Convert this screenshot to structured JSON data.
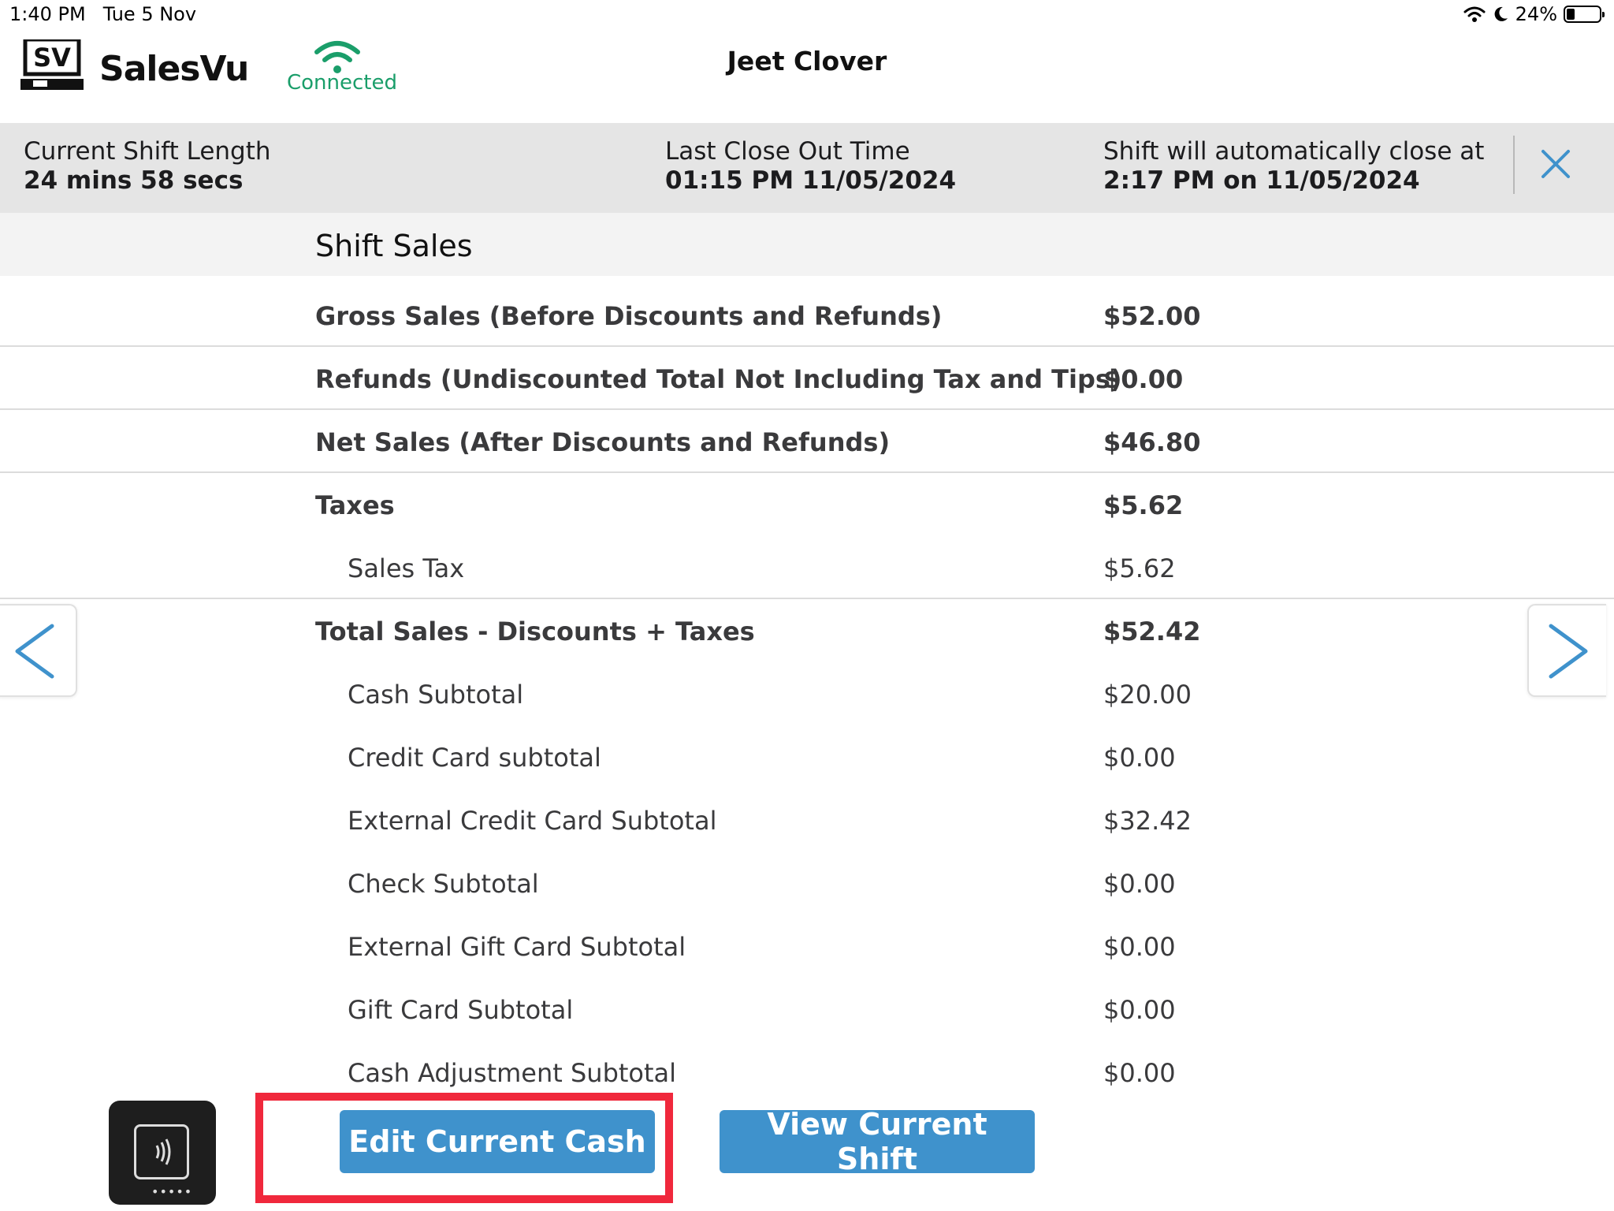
{
  "status_bar": {
    "time": "1:40 PM",
    "date": "Tue 5 Nov",
    "battery_percent_text": "24%",
    "battery_level": 0.24
  },
  "header": {
    "logo_mark": "SV",
    "app_name": "SalesVu",
    "connection_status": "Connected",
    "connection_color": "#1a9e6a",
    "user_name": "Jeet Clover"
  },
  "shift_info": {
    "length_label": "Current Shift Length",
    "length_value": "24 mins 58 secs",
    "last_close_label": "Last Close Out Time",
    "last_close_value": "01:15 PM 11/05/2024",
    "auto_close_label": "Shift will automatically close at",
    "auto_close_value": "2:17 PM on 11/05/2024"
  },
  "section_title": "Shift Sales",
  "rows": [
    {
      "label": "Gross Sales (Before Discounts and Refunds)",
      "value": "$52.00"
    },
    {
      "label": "Refunds (Undiscounted Total Not Including Tax and Tips)",
      "value": "$0.00"
    },
    {
      "label": "Net Sales (After Discounts and Refunds)",
      "value": "$46.80"
    },
    {
      "label": "Taxes",
      "value": "$5.62"
    },
    {
      "label": "Sales Tax",
      "value": "$5.62"
    },
    {
      "label": "Total Sales - Discounts + Taxes",
      "value": "$52.42"
    },
    {
      "label": "Cash Subtotal",
      "value": "$20.00"
    },
    {
      "label": "Credit Card subtotal",
      "value": "$0.00"
    },
    {
      "label": "External Credit Card Subtotal",
      "value": "$32.42"
    },
    {
      "label": "Check Subtotal",
      "value": "$0.00"
    },
    {
      "label": "External Gift Card Subtotal",
      "value": "$0.00"
    },
    {
      "label": "Gift Card Subtotal",
      "value": "$0.00"
    },
    {
      "label": "Cash Adjustment Subtotal",
      "value": "$0.00"
    }
  ],
  "buttons": {
    "edit_cash": "Edit Current Cash",
    "view_shift": "View Current Shift"
  },
  "colors": {
    "accent": "#3f92cc",
    "highlight": "#f0283c",
    "band": "#e5e5e5"
  },
  "icons": {
    "close": "close-icon",
    "prev": "chevron-left-icon",
    "next": "chevron-right-icon",
    "wifi": "wifi-icon",
    "reader": "contactless-reader-icon"
  }
}
